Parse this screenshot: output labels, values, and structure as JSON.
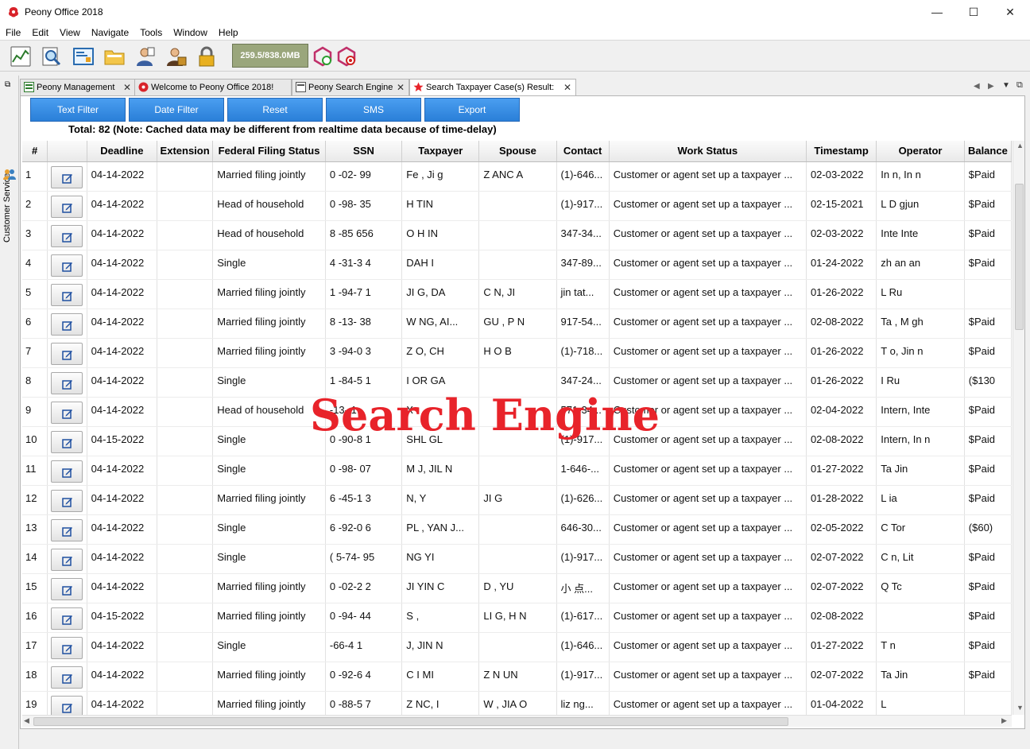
{
  "window": {
    "title": "Peony Office 2018",
    "minimize": "—",
    "maximize": "☐",
    "close": "✕"
  },
  "menu": [
    "File",
    "Edit",
    "View",
    "Navigate",
    "Tools",
    "Window",
    "Help"
  ],
  "toolbar": {
    "memory": "259.5/838.0MB"
  },
  "sidebar": {
    "label": "Customer Service"
  },
  "tabs": [
    {
      "label": "Peony Management"
    },
    {
      "label": "Welcome to Peony Office 2018!"
    },
    {
      "label": "Peony Search Engine"
    },
    {
      "label": "Search Taxpayer Case(s) Result:"
    }
  ],
  "actions": {
    "text_filter": "Text Filter",
    "date_filter": "Date Filter",
    "reset": "Reset",
    "sms": "SMS",
    "export": "Export"
  },
  "summary": "Total: 82 (Note: Cached data may be different from realtime data because of time-delay)",
  "columns": [
    "#",
    "",
    "Deadline",
    "Extension",
    "Federal Filing Status",
    "SSN",
    "Taxpayer",
    "Spouse",
    "Contact",
    "Work Status",
    "Timestamp",
    "Operator",
    "Balance"
  ],
  "rows": [
    [
      "1",
      "04-14-2022",
      "",
      "Married filing jointly",
      "0 -02- 99",
      "Fe , Ji g",
      "Z ANC A",
      "(1)-646...",
      "Customer or agent set up a taxpayer ...",
      "02-03-2022",
      "In n, In n",
      "$Paid"
    ],
    [
      "2",
      "04-14-2022",
      "",
      "Head of household",
      "0 -98- 35",
      "H TIN",
      "",
      "(1)-917...",
      "Customer or agent set up a taxpayer ...",
      "02-15-2021",
      "L D gjun",
      "$Paid"
    ],
    [
      "3",
      "04-14-2022",
      "",
      "Head of household",
      "8 -85 656",
      "O H IN",
      "",
      "347-34...",
      "Customer or agent set up a taxpayer ...",
      "02-03-2022",
      "Inte Inte",
      "$Paid"
    ],
    [
      "4",
      "04-14-2022",
      "",
      "Single",
      "4 -31-3 4",
      "DAH I",
      "",
      "347-89...",
      "Customer or agent set up a taxpayer ...",
      "01-24-2022",
      "zh an an",
      "$Paid"
    ],
    [
      "5",
      "04-14-2022",
      "",
      "Married filing jointly",
      "1 -94-7 1",
      "JI G, DA",
      "C N, JI",
      "jin tat...",
      "Customer or agent set up a taxpayer ...",
      "01-26-2022",
      "L Ru",
      ""
    ],
    [
      "6",
      "04-14-2022",
      "",
      "Married filing jointly",
      "8 -13- 38",
      "W NG, AI...",
      "GU , P N",
      "917-54...",
      "Customer or agent set up a taxpayer ...",
      "02-08-2022",
      "Ta , M gh",
      "$Paid"
    ],
    [
      "7",
      "04-14-2022",
      "",
      "Married filing jointly",
      "3 -94-0 3",
      "Z O, CH",
      "H O B",
      "(1)-718...",
      "Customer or agent set up a taxpayer ...",
      "01-26-2022",
      "T o, Jin n",
      "$Paid"
    ],
    [
      "8",
      "04-14-2022",
      "",
      "Single",
      "1 -84-5 1",
      "I OR GA",
      "",
      "347-24...",
      "Customer or agent set up a taxpayer ...",
      "01-26-2022",
      "I Ru",
      "($130"
    ],
    [
      "9",
      "04-14-2022",
      "",
      "Head of household",
      "-13- 1",
      "X",
      "",
      "571-34...",
      "Customer or agent set up a taxpayer ...",
      "02-04-2022",
      "Intern, Inte",
      "$Paid"
    ],
    [
      "10",
      "04-15-2022",
      "",
      "Single",
      "0 -90-8 1",
      "SHL GL",
      "",
      "(1)-917...",
      "Customer or agent set up a taxpayer ...",
      "02-08-2022",
      "Intern, In n",
      "$Paid"
    ],
    [
      "11",
      "04-14-2022",
      "",
      "Single",
      "0 -98- 07",
      "M J, JIL N",
      "",
      "1-646-...",
      "Customer or agent set up a taxpayer ...",
      "01-27-2022",
      "Ta Jin",
      "$Paid"
    ],
    [
      "12",
      "04-14-2022",
      "",
      "Married filing jointly",
      "6 -45-1 3",
      "N, Y",
      "JI G",
      "(1)-626...",
      "Customer or agent set up a taxpayer ...",
      "01-28-2022",
      "L ia",
      "$Paid"
    ],
    [
      "13",
      "04-14-2022",
      "",
      "Single",
      "6 -92-0 6",
      "PL , YAN J...",
      "",
      "646-30...",
      "Customer or agent set up a taxpayer ...",
      "02-05-2022",
      "C Tor",
      "($60)"
    ],
    [
      "14",
      "04-14-2022",
      "",
      "Single",
      "( 5-74- 95",
      "NG YI",
      "",
      "(1)-917...",
      "Customer or agent set up a taxpayer ...",
      "02-07-2022",
      "C n, Lit",
      "$Paid"
    ],
    [
      "15",
      "04-14-2022",
      "",
      "Married filing jointly",
      "0 -02-2 2",
      "JI YIN C",
      "D , YU",
      "小 点...",
      "Customer or agent set up a taxpayer ...",
      "02-07-2022",
      "Q Tc",
      "$Paid"
    ],
    [
      "16",
      "04-15-2022",
      "",
      "Married filing jointly",
      "0 -94- 44",
      "S ,",
      "LI G, H N",
      "(1)-617...",
      "Customer or agent set up a taxpayer ...",
      "02-08-2022",
      "",
      "$Paid"
    ],
    [
      "17",
      "04-14-2022",
      "",
      "Single",
      "-66-4 1",
      "J, JIN N",
      "",
      "(1)-646...",
      "Customer or agent set up a taxpayer ...",
      "01-27-2022",
      "T n",
      "$Paid"
    ],
    [
      "18",
      "04-14-2022",
      "",
      "Married filing jointly",
      "0 -92-6 4",
      "C I MI",
      "Z N UN",
      "(1)-917...",
      "Customer or agent set up a taxpayer ...",
      "02-07-2022",
      "Ta Jin",
      "$Paid"
    ],
    [
      "19",
      "04-14-2022",
      "",
      "Married filing jointly",
      "0 -88-5 7",
      "Z NC, I",
      "W , JIA O",
      "liz ng...",
      "Customer or agent set up a taxpayer ...",
      "01-04-2022",
      "L",
      ""
    ]
  ],
  "watermark": "Search Engine"
}
